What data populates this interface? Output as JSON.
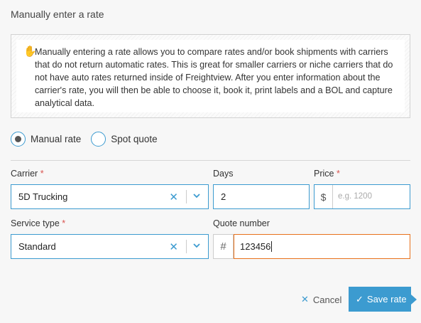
{
  "title": "Manually enter a rate",
  "notice": {
    "icon": "hand-icon",
    "text": "Manually entering a rate allows you to compare rates and/or book shipments with carriers that do not return automatic rates. This is great for smaller carriers or niche carriers that do not have auto rates returned inside of Freightview. After you enter information about the carrier's rate, you will then be able to choose it, book it, print labels and a BOL and capture analytical data."
  },
  "rate_type": {
    "options": [
      "Manual rate",
      "Spot quote"
    ],
    "selected": "Manual rate"
  },
  "carrier": {
    "label": "Carrier",
    "required": "*",
    "value": "5D Trucking"
  },
  "days": {
    "label": "Days",
    "value": "2"
  },
  "price": {
    "label": "Price",
    "required": "*",
    "addon": "$",
    "placeholder": "e.g. 1200"
  },
  "service_type": {
    "label": "Service type",
    "required": "*",
    "value": "Standard"
  },
  "quote_number": {
    "label": "Quote number",
    "addon": "#",
    "value": "123456"
  },
  "actions": {
    "cancel": "Cancel",
    "save": "Save rate"
  },
  "colors": {
    "accent": "#3c9bd0",
    "focus": "#e8721c",
    "required": "#d9534f"
  }
}
